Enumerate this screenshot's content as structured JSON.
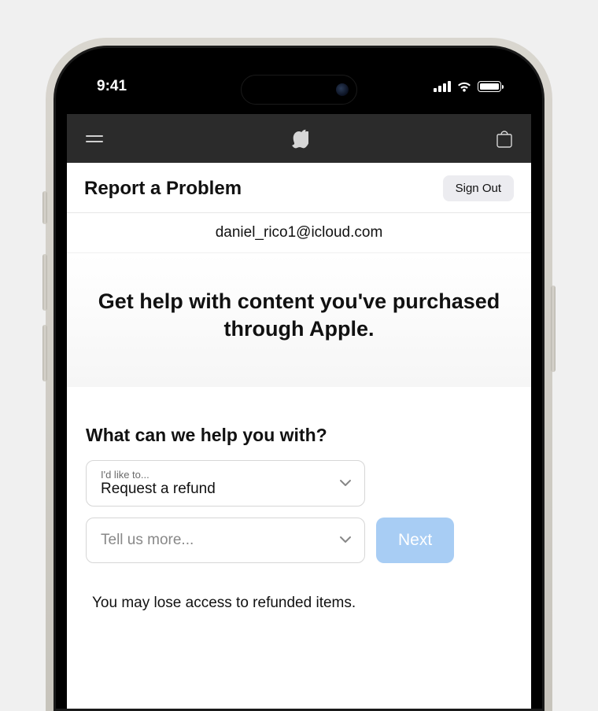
{
  "statusBar": {
    "time": "9:41"
  },
  "pageHeader": {
    "title": "Report a Problem",
    "signOutLabel": "Sign Out"
  },
  "user": {
    "email": "daniel_rico1@icloud.com"
  },
  "hero": {
    "title": "Get help with content you've purchased through Apple."
  },
  "form": {
    "sectionTitle": "What can we help you with?",
    "select1": {
      "smallLabel": "I'd like to...",
      "value": "Request a refund"
    },
    "select2": {
      "placeholder": "Tell us more..."
    },
    "nextLabel": "Next",
    "disclaimer": "You may lose access to refunded items."
  }
}
